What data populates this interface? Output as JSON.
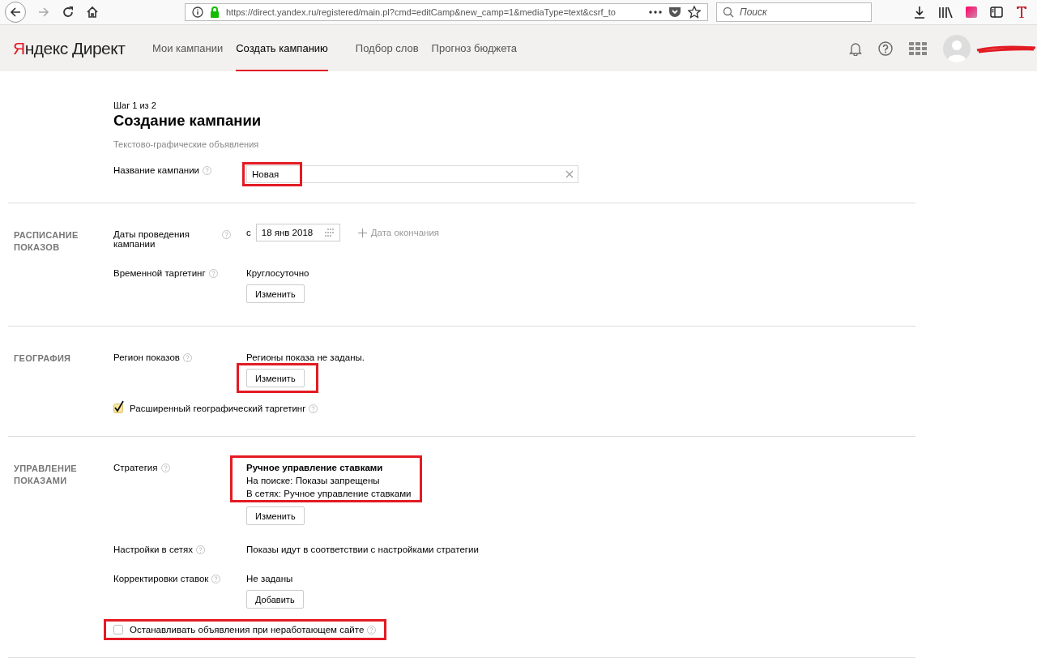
{
  "browser": {
    "url": "https://direct.yandex.ru/registered/main.pl?cmd=editCamp&new_camp=1&mediaType=text&csrf_to",
    "search_placeholder": "Поиск"
  },
  "header": {
    "logo": "Яндекс Директ",
    "nav": [
      {
        "label": "Мои кампании",
        "selected": false
      },
      {
        "label": "Создать кампанию",
        "selected": true
      },
      {
        "label": "Подбор слов",
        "selected": false
      },
      {
        "label": "Прогноз бюджета",
        "selected": false
      }
    ]
  },
  "page": {
    "step": "Шаг 1 из 2",
    "title": "Создание кампании",
    "subtitle": "Текстово-графические объявления"
  },
  "name_field": {
    "label": "Название кампании",
    "value": "Новая",
    "highlighted": true
  },
  "sections": [
    {
      "title": "РАСПИСАНИЕ ПОКАЗОВ",
      "rows": [
        {
          "kind": "dates",
          "label": "Даты проведения кампании",
          "prefix": "с",
          "date": "18 янв 2018",
          "link": "Дата окончания"
        },
        {
          "kind": "value",
          "label": "Временной таргетинг",
          "lines": [
            {
              "text": "Круглосуточно",
              "bold": false
            }
          ],
          "button": "Изменить",
          "text_highlighted": false,
          "button_highlighted": false
        }
      ]
    },
    {
      "title": "ГЕОГРАФИЯ",
      "rows": [
        {
          "kind": "value",
          "label": "Регион показов",
          "lines": [
            {
              "text": "Регионы показа не заданы.",
              "bold": false
            }
          ],
          "button": "Изменить",
          "text_highlighted": false,
          "button_highlighted": true
        },
        {
          "kind": "checkbox",
          "label": "Расширенный географический таргетинг",
          "checked": true,
          "highlighted": false
        }
      ]
    },
    {
      "title": "УПРАВЛЕНИЕ ПОКАЗАМИ",
      "rows": [
        {
          "kind": "value",
          "label": "Стратегия",
          "lines": [
            {
              "text": "Ручное управление ставками",
              "bold": true
            },
            {
              "text": "На поиске: Показы запрещены",
              "bold": false
            },
            {
              "text": "В сетях: Ручное управление ставками",
              "bold": false
            }
          ],
          "button": "Изменить",
          "text_highlighted": true,
          "button_highlighted": false
        },
        {
          "kind": "value",
          "label": "Настройки в сетях",
          "lines": [
            {
              "text": "Показы идут в соответствии с настройками стратегии",
              "bold": false
            }
          ],
          "text_highlighted": false,
          "button_highlighted": false
        },
        {
          "kind": "value",
          "label": "Корректировки ставок",
          "lines": [
            {
              "text": "Не заданы",
              "bold": false
            }
          ],
          "button": "Добавить",
          "text_highlighted": false,
          "button_highlighted": false
        },
        {
          "kind": "checkbox",
          "label": "Останавливать объявления при неработающем сайте",
          "checked": false,
          "highlighted": true
        }
      ]
    }
  ]
}
